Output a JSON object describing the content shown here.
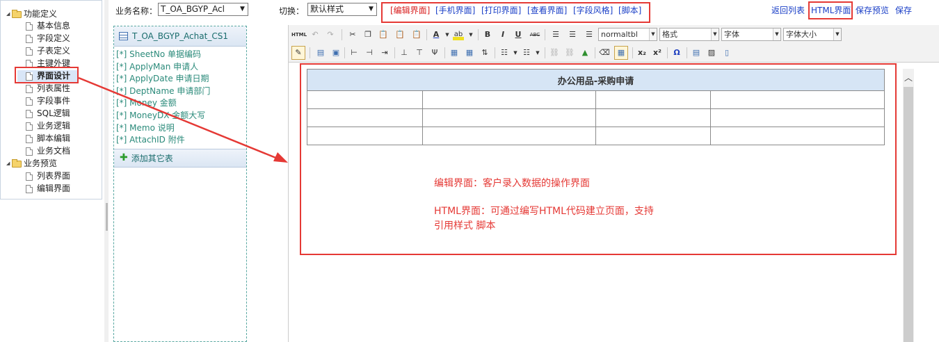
{
  "tree": {
    "root1": "功能定义",
    "items1": [
      "基本信息",
      "字段定义",
      "子表定义",
      "主键外键",
      "界面设计",
      "列表属性",
      "字段事件",
      "SQL逻辑",
      "业务逻辑",
      "脚本编辑",
      "业务文档"
    ],
    "root2": "业务预览",
    "items2": [
      "列表界面",
      "编辑界面"
    ]
  },
  "toolbar": {
    "biz_label": "业务名称：",
    "biz_value": "T_OA_BGYP_Acl",
    "switch_label": "切换：",
    "switch_value": "默认样式",
    "tabs": [
      "[编辑界面]",
      "[手机界面]",
      "[打印界面]",
      "[查看界面]",
      "[字段风格]",
      "[脚本]"
    ],
    "back": "返回列表",
    "html": "HTML界面",
    "save_preview": "保存预览",
    "save": "保存"
  },
  "fields": {
    "table_name": "T_OA_BGYP_Achat_CS1",
    "items": [
      "[*]  SheetNo  单据编码",
      "[*]  ApplyMan  申请人",
      "[*]  ApplyDate  申请日期",
      "[*]  DeptName  申请部门",
      "[*]  Money  金额",
      "[*]  MoneyDX  金额大写",
      "[*]  Memo  说明",
      "[*]  AttachID  附件"
    ],
    "add_table": "添加其它表"
  },
  "editor": {
    "style_value": "normaltbl",
    "format_value": "格式",
    "font_value": "字体",
    "size_value": "字体大小",
    "table_title": "办公用品-采购申请"
  },
  "notes": {
    "line1": "编辑界面：客户录入数据的操作界面",
    "line2": "HTML界面：可通过编写HTML代码建立页面，支持",
    "line3": "引用样式 脚本"
  },
  "colors": {
    "accent_red": "#e53935",
    "link_blue": "#1a3fc7",
    "field_teal": "#2a8a7a"
  }
}
